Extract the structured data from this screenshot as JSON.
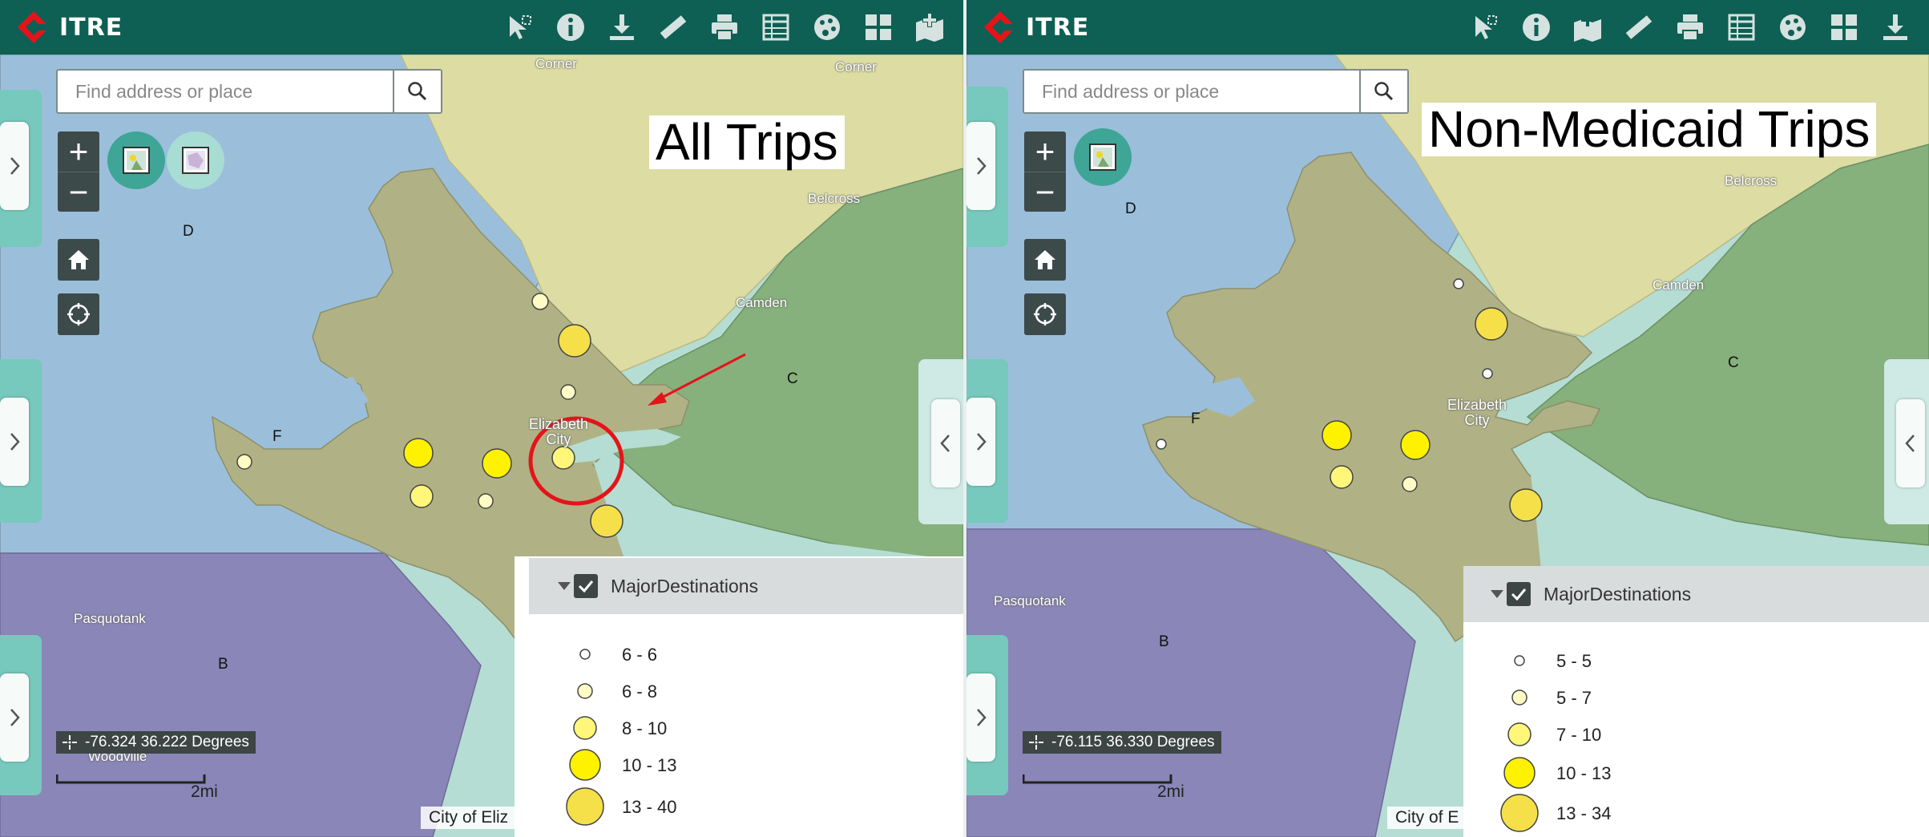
{
  "app": {
    "logo_text": "ITRE",
    "search_placeholder": "Find address or place",
    "zoom_in": "+",
    "zoom_out": "−"
  },
  "colors": {
    "header": "#0e5f54",
    "water_light": "#b5ddd3",
    "county_d": "#9bbfdb",
    "county_b": "#8a86b8",
    "county_c": "#86b07c",
    "north_area": "#dcdca3",
    "city_region": "#b0b285",
    "marker_fill": "#fff200",
    "annotation_red": "#e4141a"
  },
  "toolbar_icons_left": [
    "select-icon",
    "info-icon",
    "download-icon",
    "measure-icon",
    "print-icon",
    "attribute-table-icon",
    "basemap-icon",
    "layout-icon",
    "add-data-icon"
  ],
  "toolbar_icons_right": [
    "select-icon",
    "info-icon",
    "add-data-icon",
    "measure-icon",
    "print-icon",
    "attribute-table-icon",
    "basemap-icon",
    "layout-icon",
    "download-icon"
  ],
  "left_map": {
    "title": "All Trips",
    "coordinates": "-76.324 36.222 Degrees",
    "scale_label": "2mi",
    "attribution": "City of Eliz",
    "place_labels": {
      "corner_a": "Corner",
      "corner_b": "Corner",
      "belcross": "Belcross",
      "camden": "Camden",
      "pasquotank": "Pasquotank",
      "woodville": "Woodville",
      "city_line1": "Elizabeth",
      "city_line2": "City"
    },
    "region_letters": {
      "d": "D",
      "c": "C",
      "f": "F",
      "b": "B"
    },
    "legend": {
      "title": "MajorDestinations",
      "classes": [
        "6 - 6",
        "6 - 8",
        "8 - 10",
        "10 - 13",
        "13 - 40"
      ]
    }
  },
  "right_map": {
    "title": "Non-Medicaid Trips",
    "coordinates": "-76.115 36.330 Degrees",
    "scale_label": "2mi",
    "attribution": "City of E",
    "place_labels": {
      "belcross": "Belcross",
      "camden": "Camden",
      "pasquotank": "Pasquotank",
      "city_line1": "Elizabeth",
      "city_line2": "City"
    },
    "region_letters": {
      "d": "D",
      "c": "C",
      "f": "F",
      "b": "B"
    },
    "legend": {
      "title": "MajorDestinations",
      "classes": [
        "5 - 5",
        "5 - 7",
        "7 - 10",
        "10 - 13",
        "13 - 34"
      ]
    }
  }
}
